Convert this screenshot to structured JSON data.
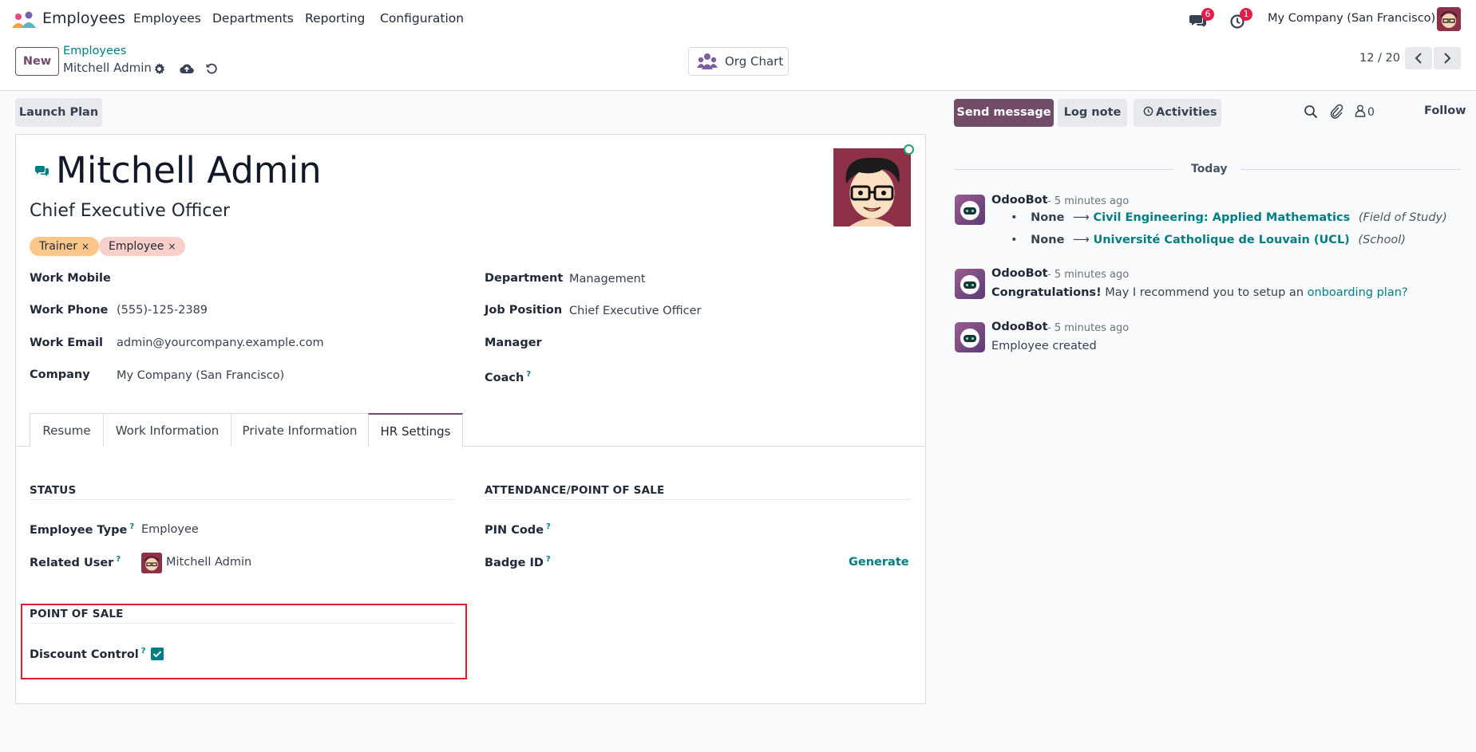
{
  "navbar": {
    "app_name": "Employees",
    "menus": [
      "Employees",
      "Departments",
      "Reporting",
      "Configuration"
    ],
    "messages_badge": "6",
    "activities_badge": "1",
    "company": "My Company (San Francisco)"
  },
  "control_panel": {
    "new_label": "New",
    "breadcrumb_parent": "Employees",
    "breadcrumb_current": "Mitchell Admin",
    "org_chart_label": "Org Chart",
    "pager": "12 / 20"
  },
  "form": {
    "launch_plan_label": "Launch Plan",
    "name": "Mitchell Admin",
    "job_title": "Chief Executive Officer",
    "tags": [
      "Trainer",
      "Employee"
    ],
    "fields_left": [
      {
        "label": "Work Mobile",
        "value": ""
      },
      {
        "label": "Work Phone",
        "value": "(555)-125-2389"
      },
      {
        "label": "Work Email",
        "value": "admin@yourcompany.example.com"
      },
      {
        "label": "Company",
        "value": "My Company (San Francisco)"
      }
    ],
    "fields_right": [
      {
        "label": "Department",
        "value": "Management"
      },
      {
        "label": "Job Position",
        "value": "Chief Executive Officer"
      },
      {
        "label": "Manager",
        "value": ""
      },
      {
        "label": "Coach",
        "value": ""
      }
    ],
    "tabs": [
      "Resume",
      "Work Information",
      "Private Information",
      "HR Settings"
    ],
    "active_tab": "HR Settings",
    "status": {
      "title": "STATUS",
      "employee_type_label": "Employee Type",
      "employee_type_value": "Employee",
      "related_user_label": "Related User",
      "related_user_value": "Mitchell Admin"
    },
    "attendance": {
      "title": "ATTENDANCE/POINT OF SALE",
      "pin_label": "PIN Code",
      "badge_label": "Badge ID",
      "generate_label": "Generate"
    },
    "pos": {
      "title": "POINT OF SALE",
      "discount_label": "Discount Control",
      "discount_checked": true
    },
    "help_mark": "?"
  },
  "chatter": {
    "send_message_label": "Send message",
    "log_note_label": "Log note",
    "activities_label": "Activities",
    "followers_count": "0",
    "follow_label": "Follow",
    "date_separator": "Today",
    "messages": [
      {
        "author": "OdooBot",
        "time": "- 5 minutes ago",
        "changes": [
          {
            "old": "None",
            "new": "Civil Engineering: Applied Mathematics",
            "field": "(Field of Study)"
          },
          {
            "old": "None",
            "new": "Université Catholique de Louvain (UCL)",
            "field": "(School)"
          }
        ]
      },
      {
        "author": "OdooBot",
        "time": "- 5 minutes ago",
        "bold": "Congratulations!",
        "text": " May I recommend you to setup an ",
        "link": "onboarding plan?"
      },
      {
        "author": "OdooBot",
        "time": "- 5 minutes ago",
        "text": "Employee created"
      }
    ]
  },
  "colors": {
    "brand": "#714b67",
    "accent": "#017e84",
    "highlight_box": "#e11d2a",
    "tag_trainer": "#fbc68a",
    "tag_employee": "#f9d0c9"
  }
}
